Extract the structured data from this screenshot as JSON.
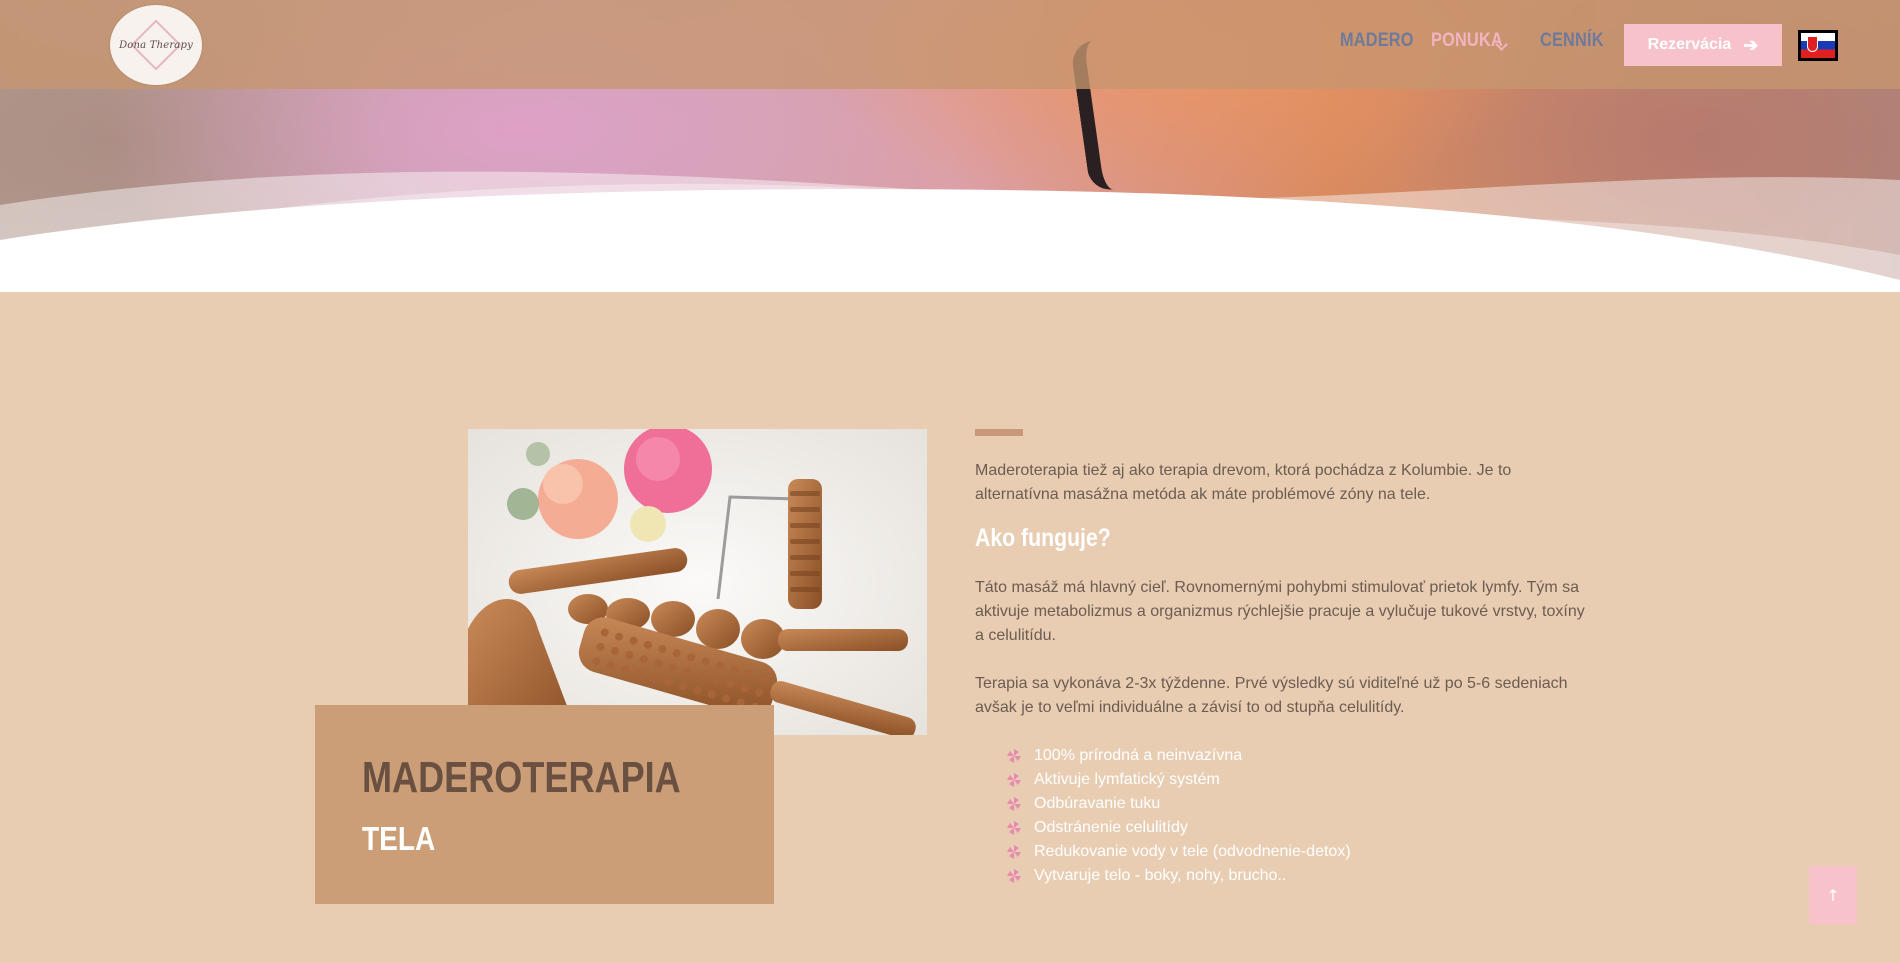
{
  "header": {
    "logo_text": "Dona Therapy",
    "nav": [
      {
        "label": "MADERO"
      },
      {
        "label": "PONUKA"
      },
      {
        "label": "CENNÍK"
      }
    ],
    "reserve_button": "Rezervácia",
    "language": "SK"
  },
  "section": {
    "title": "MADEROTERAPIA",
    "subtitle": "TELA",
    "intro": "Maderoterapia tiež aj ako terapia drevom, ktorá pochádza z Kolumbie. Je to alternatívna masážna metóda ak máte problémové zóny na tele.",
    "heading": "Ako funguje?",
    "paragraph1": "Táto masáž má hlavný cieľ. Rovnomernými pohybmi stimulovať prietok lymfy. Tým sa aktivuje metabolizmus a organizmus rýchlejšie pracuje a vylučuje tukové vrstvy, toxíny a celulitídu.",
    "paragraph2": "Terapia sa vykonáva 2-3x týždenne. Prvé výsledky sú viditeľné už po 5-6 sedeniach avšak je to veľmi individuálne a závisí to od stupňa celulitídy.",
    "features": [
      "100% prírodná a neinvazívna",
      "Aktivuje lymfatický systém",
      "Odbúravanie tuku",
      "Odstránenie celulitídy",
      "Redukovanie vody v tele (odvodnenie-detox)",
      "Vytvaruje telo - boky, nohy, brucho.."
    ]
  },
  "icons": {
    "feature_icon": "pinwheel-icon",
    "back_to_top_icon": "arrow-up-icon",
    "reserve_arrow": "arrow-right-icon",
    "nav_dropdown": "chevron-down-icon"
  },
  "colors": {
    "page_background": "#e8cdb2",
    "header_background": "#c79670",
    "accent_pink": "#f8c2cb",
    "nav_blue": "#6e7a9a",
    "card_brown": "#cb9e78",
    "text": "#6c5c52"
  }
}
